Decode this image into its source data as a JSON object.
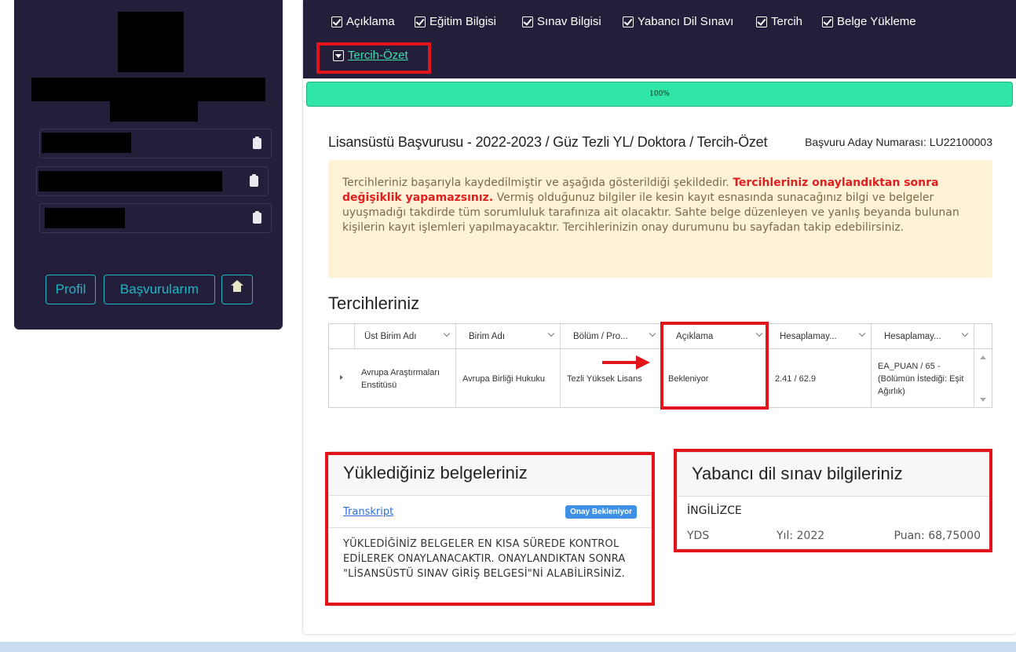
{
  "sidebar": {
    "buttons": {
      "profile": "Profil",
      "applications": "Başvurularım"
    }
  },
  "topnav": {
    "items": [
      {
        "label": "Açıklama"
      },
      {
        "label": "Eğitim Bilgisi"
      },
      {
        "label": "Sınav Bilgisi"
      },
      {
        "label": "Yabancı Dil Sınavı"
      },
      {
        "label": "Tercih"
      },
      {
        "label": "Belge Yükleme"
      }
    ],
    "active": {
      "label": "Tercih-Özet"
    }
  },
  "progress": {
    "value": 1.0,
    "text": "100%"
  },
  "page": {
    "title": "Lisansüstü Başvurusu - 2022-2023 / Güz Tezli YL/ Doktora / Tercih-Özet",
    "application_no": "Başvuru Aday Numarası: LU22100003"
  },
  "alert": {
    "part1": "Tercihleriniz başarıyla kaydedilmiştir ve aşağıda gösterildiği şekildedir. ",
    "part2_strong": "Tercihleriniz onaylandıktan sonra değişiklik yapamazsınız.",
    "part3": " Vermiş olduğunuz bilgiler ile kesin kayıt esnasında sunacağınız bilgi ve belgeler uyuşmadığı takdirde tüm sorumluluk tarafınıza ait olacaktır. Sahte belge düzenleyen ve yanlış beyanda bulunan kişilerin kayıt işlemleri yapılmayacaktır. Tercihlerinizin onay durumunu bu sayfadan takip edebilirsiniz."
  },
  "preferences": {
    "title": "Tercihleriniz",
    "columns": [
      "Üst Birim Adı",
      "Birim Adı",
      "Bölüm / Pro...",
      "Açıklama",
      "Hesaplamay...",
      "Hesaplamay..."
    ],
    "rows": [
      [
        "Avrupa Araştırmaları Enstitüsü",
        "Avrupa Birliği Hukuku",
        "Tezli Yüksek Lisans",
        "Bekleniyor",
        "2.41 / 62.9",
        "EA_PUAN / 65 - (Bölümün İstediği: Eşit Ağırlık)"
      ]
    ]
  },
  "documents": {
    "title": "Yüklediğiniz belgeleriniz",
    "link": "Transkript",
    "badge": "Onay Bekleniyor",
    "note": "YÜKLEDİĞİNİZ BELGELER EN KISA SÜREDE KONTROL EDİLEREK ONAYLANACAKTIR. ONAYLANDIKTAN SONRA \"LİSANSÜSTÜ SINAV GİRİŞ BELGESİ\"Nİ ALABİLİRSİNİZ."
  },
  "language": {
    "title": "Yabancı dil sınav bilgileriniz",
    "name": "İNGİLİZCE",
    "exam": "YDS",
    "year": "Yıl: 2022",
    "score": "Puan: 68,75000"
  },
  "colors": {
    "sidebar_bg": "#231f3a",
    "progress": "#2fe6a6",
    "highlight_red": "#e1141c",
    "accent_teal": "#1fb6c8"
  }
}
